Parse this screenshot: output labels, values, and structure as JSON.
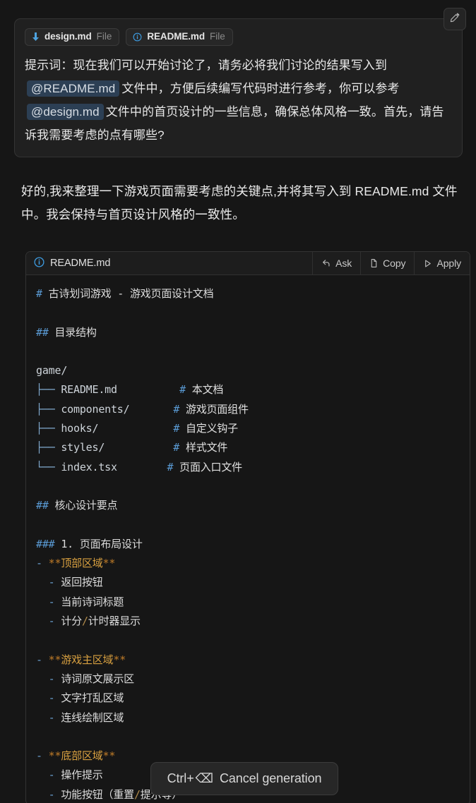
{
  "prompt": {
    "files": [
      {
        "name": "design.md",
        "kind": "File",
        "icon": "pin-icon"
      },
      {
        "name": "README.md",
        "kind": "File",
        "icon": "info-circle-icon"
      }
    ],
    "segments": [
      {
        "type": "text",
        "value": "提示词：现在我们可以开始讨论了，请务必将我们讨论的结果写入到"
      },
      {
        "type": "mention",
        "value": "@README.md"
      },
      {
        "type": "text",
        "value": "文件中，方便后续编写代码时进行参考，你可以参考"
      },
      {
        "type": "mention",
        "value": "@design.md"
      },
      {
        "type": "text",
        "value": "文件中的首页设计的一些信息，确保总体风格一致。首先，请告诉我需要考虑的点有哪些?"
      }
    ],
    "edit_button_label": "Edit"
  },
  "assistant": {
    "reply": "好的,我来整理一下游戏页面需要考虑的关键点,并将其写入到 README.md 文件中。我会保持与首页设计风格的一致性。"
  },
  "code_block": {
    "filename": "README.md",
    "file_icon": "info-circle-icon",
    "actions": [
      {
        "label": "Ask",
        "icon": "reply-arrow-icon"
      },
      {
        "label": "Copy",
        "icon": "copy-icon"
      },
      {
        "label": "Apply",
        "icon": "play-triangle-icon"
      }
    ],
    "lines": [
      [
        {
          "c": "hash",
          "t": "#"
        },
        {
          "c": "txt",
          "t": " 古诗划词游戏 - 游戏页面设计文档"
        }
      ],
      [],
      [
        {
          "c": "hash",
          "t": "##"
        },
        {
          "c": "txt",
          "t": " 目录结构"
        }
      ],
      [],
      [
        {
          "c": "path",
          "t": "game/"
        }
      ],
      [
        {
          "c": "tree",
          "t": "├──"
        },
        {
          "c": "path",
          "t": " README.md"
        },
        {
          "c": "txt",
          "t": "          "
        },
        {
          "c": "hash",
          "t": "#"
        },
        {
          "c": "cmt",
          "t": " 本文档"
        }
      ],
      [
        {
          "c": "tree",
          "t": "├──"
        },
        {
          "c": "path",
          "t": " components/"
        },
        {
          "c": "txt",
          "t": "       "
        },
        {
          "c": "hash",
          "t": "#"
        },
        {
          "c": "cmt",
          "t": " 游戏页面组件"
        }
      ],
      [
        {
          "c": "tree",
          "t": "├──"
        },
        {
          "c": "path",
          "t": " hooks/"
        },
        {
          "c": "txt",
          "t": "            "
        },
        {
          "c": "hash",
          "t": "#"
        },
        {
          "c": "cmt",
          "t": " 自定义钩子"
        }
      ],
      [
        {
          "c": "tree",
          "t": "├──"
        },
        {
          "c": "path",
          "t": " styles/"
        },
        {
          "c": "txt",
          "t": "           "
        },
        {
          "c": "hash",
          "t": "#"
        },
        {
          "c": "cmt",
          "t": " 样式文件"
        }
      ],
      [
        {
          "c": "tree",
          "t": "└──"
        },
        {
          "c": "path",
          "t": " index.tsx"
        },
        {
          "c": "txt",
          "t": "        "
        },
        {
          "c": "hash",
          "t": "#"
        },
        {
          "c": "cmt",
          "t": " 页面入口文件"
        }
      ],
      [],
      [
        {
          "c": "hash",
          "t": "##"
        },
        {
          "c": "txt",
          "t": " 核心设计要点"
        }
      ],
      [],
      [
        {
          "c": "hash",
          "t": "###"
        },
        {
          "c": "txt",
          "t": " 1. 页面布局设计"
        }
      ],
      [
        {
          "c": "dash",
          "t": "-"
        },
        {
          "c": "ast",
          "t": " **"
        },
        {
          "c": "bold",
          "t": "顶部区域"
        },
        {
          "c": "ast",
          "t": "**"
        }
      ],
      [
        {
          "c": "txt",
          "t": "  "
        },
        {
          "c": "dash",
          "t": "-"
        },
        {
          "c": "txt",
          "t": " 返回按钮"
        }
      ],
      [
        {
          "c": "txt",
          "t": "  "
        },
        {
          "c": "dash",
          "t": "-"
        },
        {
          "c": "txt",
          "t": " 当前诗词标题"
        }
      ],
      [
        {
          "c": "txt",
          "t": "  "
        },
        {
          "c": "dash",
          "t": "-"
        },
        {
          "c": "txt",
          "t": " 计分"
        },
        {
          "c": "slash",
          "t": "/"
        },
        {
          "c": "txt",
          "t": "计时器显示"
        }
      ],
      [],
      [
        {
          "c": "dash",
          "t": "-"
        },
        {
          "c": "ast",
          "t": " **"
        },
        {
          "c": "bold",
          "t": "游戏主区域"
        },
        {
          "c": "ast",
          "t": "**"
        }
      ],
      [
        {
          "c": "txt",
          "t": "  "
        },
        {
          "c": "dash",
          "t": "-"
        },
        {
          "c": "txt",
          "t": " 诗词原文展示区"
        }
      ],
      [
        {
          "c": "txt",
          "t": "  "
        },
        {
          "c": "dash",
          "t": "-"
        },
        {
          "c": "txt",
          "t": " 文字打乱区域"
        }
      ],
      [
        {
          "c": "txt",
          "t": "  "
        },
        {
          "c": "dash",
          "t": "-"
        },
        {
          "c": "txt",
          "t": " 连线绘制区域"
        }
      ],
      [],
      [
        {
          "c": "dash",
          "t": "-"
        },
        {
          "c": "ast",
          "t": " **"
        },
        {
          "c": "bold",
          "t": "底部区域"
        },
        {
          "c": "ast",
          "t": "**"
        }
      ],
      [
        {
          "c": "txt",
          "t": "  "
        },
        {
          "c": "dash",
          "t": "-"
        },
        {
          "c": "txt",
          "t": " 操作提示"
        }
      ],
      [
        {
          "c": "txt",
          "t": "  "
        },
        {
          "c": "dash",
          "t": "-"
        },
        {
          "c": "txt",
          "t": " 功能按钮（重置"
        },
        {
          "c": "slash",
          "t": "/"
        },
        {
          "c": "txt",
          "t": "提示等）"
        }
      ]
    ]
  },
  "cancel": {
    "shortcut": "Ctrl+",
    "key_glyph": "⌫",
    "label": "Cancel generation"
  },
  "colors": {
    "page_bg": "#161616",
    "prompt_bg": "#202020",
    "mention_bg": "#2c3f54",
    "accent_blue": "#5a9bd5",
    "accent_gold": "#d8a040"
  }
}
